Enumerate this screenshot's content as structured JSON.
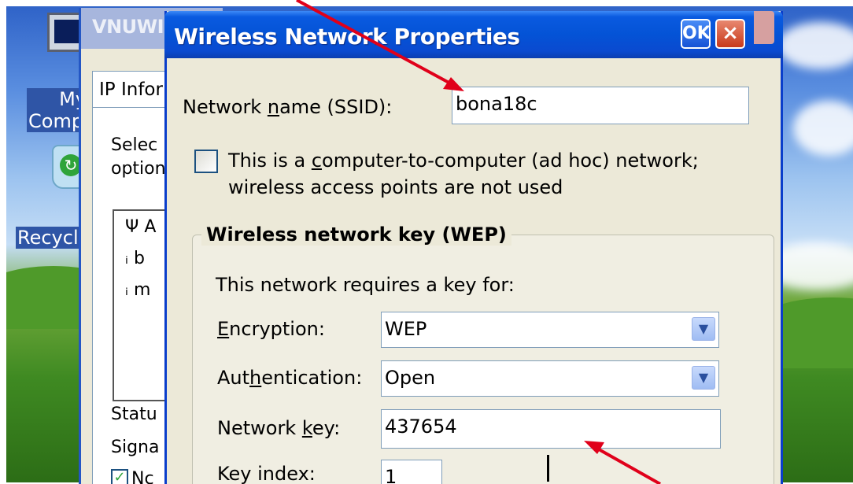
{
  "desktop": {
    "icons": [
      {
        "name": "my-computer",
        "label_line1": "My",
        "label_line2": "Compu"
      },
      {
        "name": "recycle-bin",
        "label": "Recycle"
      }
    ]
  },
  "background_window": {
    "title": "VNUWI",
    "tab_label": "IP Infor",
    "text_select_line1": "Selec",
    "text_select_line2": "option",
    "list_items": [
      {
        "icon": "antenna-icon",
        "text": "A"
      },
      {
        "icon": "signal-icon",
        "text": "b"
      },
      {
        "icon": "signal-icon",
        "text": "m"
      }
    ],
    "status_label": "Statu",
    "signal_label": "Signa",
    "checkbox_label": "Nc"
  },
  "dialog": {
    "title": "Wireless Network Properties",
    "ok_label": "OK",
    "close_label": "×",
    "ssid": {
      "label_pre": "Network ",
      "label_u": "n",
      "label_post": "ame (SSID):",
      "value": "bona18c"
    },
    "adhoc": {
      "line1_pre": "This is a ",
      "line1_u": "c",
      "line1_post": "omputer-to-computer (ad hoc) network;",
      "line2": "wireless access points are not used",
      "checked": false
    },
    "wep_group": {
      "heading": "Wireless network key (WEP)",
      "requires_text": "This network requires a key for:",
      "encryption": {
        "label_u": "E",
        "label_post": "ncryption:",
        "value": "WEP"
      },
      "authentication": {
        "label_pre": "Aut",
        "label_u": "h",
        "label_post": "entication:",
        "value": "Open"
      },
      "network_key": {
        "label_pre": "Network ",
        "label_u": "k",
        "label_post": "ey:",
        "value": "437654"
      },
      "key_index": {
        "label": "Key index:",
        "value": "1"
      }
    }
  },
  "colors": {
    "titlebar": "#0453d6",
    "dialog_bg": "#ece9d8",
    "annotation_arrow": "#e0001a"
  }
}
